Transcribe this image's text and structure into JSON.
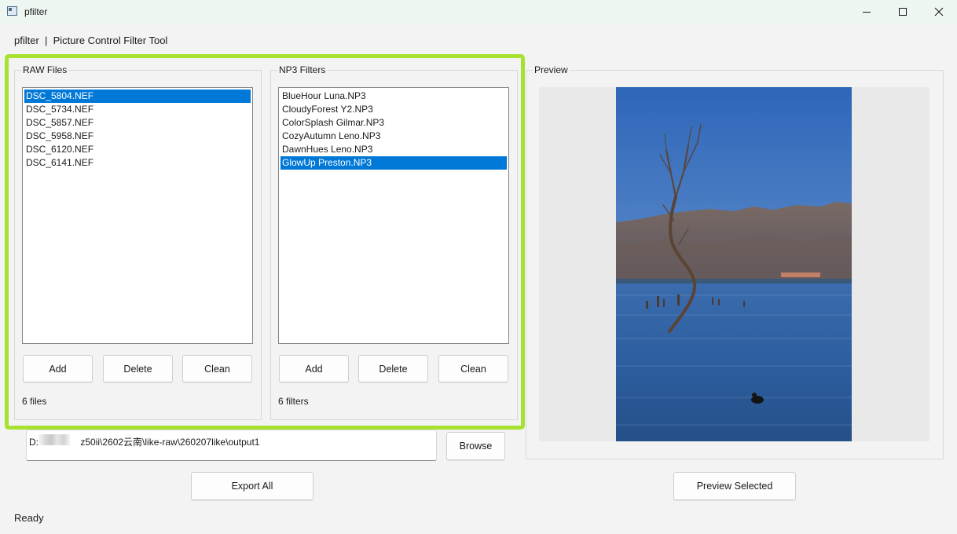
{
  "window": {
    "title": "pfilter",
    "controls": [
      "minimize-icon",
      "maximize-icon",
      "close-icon"
    ]
  },
  "header": {
    "subtitle": "pfilter  |  Picture Control Filter Tool"
  },
  "raw_files": {
    "title": "RAW Files",
    "items": [
      "DSC_5804.NEF",
      "DSC_5734.NEF",
      "DSC_5857.NEF",
      "DSC_5958.NEF",
      "DSC_6120.NEF",
      "DSC_6141.NEF"
    ],
    "selected": "DSC_5804.NEF",
    "buttons": {
      "add": "Add",
      "delete": "Delete",
      "clean": "Clean"
    },
    "count": "6 files"
  },
  "np3_filters": {
    "title": "NP3 Filters",
    "items": [
      "BlueHour Luna.NP3",
      "CloudyForest Y2.NP3",
      "ColorSplash Gilmar.NP3",
      "CozyAutumn Leno.NP3",
      "DawnHues Leno.NP3",
      "GlowUp Preston.NP3"
    ],
    "selected": "GlowUp Preston.NP3",
    "buttons": {
      "add": "Add",
      "delete": "Delete",
      "clean": "Clean"
    },
    "count": "6 filters"
  },
  "output": {
    "path_prefix": "D:\\",
    "path_rest": "z50ii\\2602云南\\like-raw\\260207like\\output1",
    "browse_label": "Browse",
    "export_label": "Export All"
  },
  "preview": {
    "title": "Preview",
    "button_label": "Preview Selected"
  },
  "status": {
    "text": "Ready"
  },
  "colors": {
    "selection": "#0078d7",
    "highlight_frame": "#a6e22e",
    "titlebar": "#eef6f2"
  }
}
